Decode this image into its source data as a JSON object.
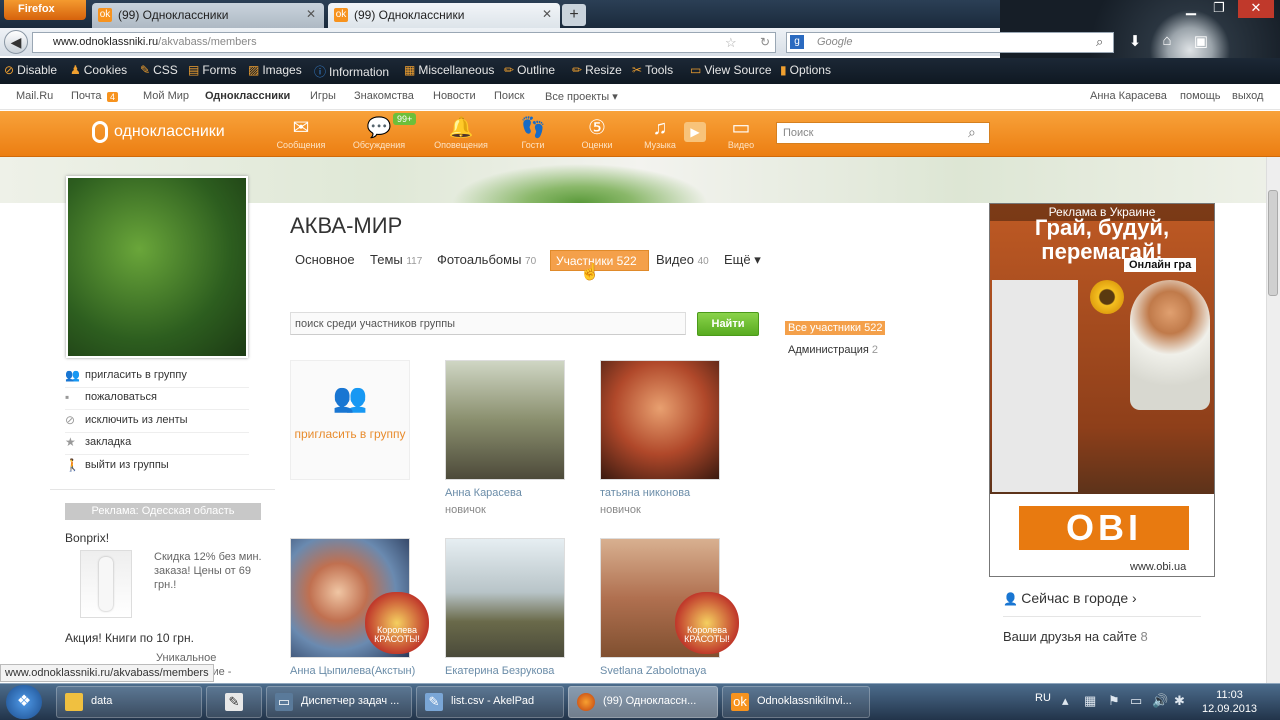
{
  "browser": {
    "menu_button": "Firefox",
    "tabs": [
      {
        "label": "(99) Одноклассники",
        "active": false
      },
      {
        "label": "(99) Одноклассники",
        "active": true
      }
    ],
    "url_domain": "www.odnoklassniki.ru",
    "url_path": "/akvabass/members",
    "search_placeholder": "Google",
    "bookmarks": [
      "Disable",
      "Cookies",
      "CSS",
      "Forms",
      "Images",
      "Information",
      "Miscellaneous",
      "Outline",
      "Resize",
      "Tools",
      "View Source",
      "Options"
    ]
  },
  "site_topline": {
    "links": [
      "Mail.Ru",
      "Почта",
      "Мой Мир",
      "Одноклассники",
      "Игры",
      "Знакомства",
      "Новости",
      "Поиск",
      "Все проекты ▾"
    ],
    "mail_badge": "4",
    "user_name": "Анна Карасева",
    "help": "помощь",
    "logout": "выход"
  },
  "ok_header": {
    "logo": "одноклассники",
    "items": [
      {
        "label": "Сообщения",
        "icon": "envelope-icon"
      },
      {
        "label": "Обсуждения",
        "icon": "chat-icon"
      },
      {
        "label": "Оповещения",
        "icon": "bell-icon"
      },
      {
        "label": "Гости",
        "icon": "footprints-icon"
      },
      {
        "label": "Оценки",
        "icon": "rating-icon"
      },
      {
        "label": "Музыка",
        "icon": "music-icon"
      },
      {
        "label": "Видео",
        "icon": "video-icon"
      }
    ],
    "discussions_badge": "99+",
    "search_placeholder": "Поиск"
  },
  "left": {
    "actions": [
      "пригласить в группу",
      "пожаловаться",
      "исключить из ленты",
      "закладка",
      "выйти из группы"
    ],
    "ad_title": "Реклама: Одесская область",
    "ad1_title": "Bonprix!",
    "ad1_text": "Скидка 12% без мин. заказа! Цены от 69 грн.!",
    "ad2_title": "Акция! Книги по 10 грн.",
    "ad2_text": "Уникальное предложение -"
  },
  "group": {
    "title": "АКВА-МИР",
    "tabs": [
      {
        "label": "Основное",
        "count": ""
      },
      {
        "label": "Темы",
        "count": "117"
      },
      {
        "label": "Фотоальбомы",
        "count": "70"
      },
      {
        "label": "Участники",
        "count": "522"
      },
      {
        "label": "Видео",
        "count": "40"
      },
      {
        "label": "Ещё ▾",
        "count": ""
      }
    ],
    "active_tab": "Участники 522",
    "member_search_placeholder": "поиск среди участников группы",
    "find_button": "Найти",
    "filter_all": "Все участники 522",
    "filter_admin": "Администрация",
    "filter_admin_count": "2",
    "invite_card": "пригласить в группу",
    "members": [
      {
        "name": "Анна Карасева",
        "status": "новичок"
      },
      {
        "name": "татьяна никонова",
        "status": "новичок"
      },
      {
        "name": "Анна Цыпилева(Акстын)",
        "status": ""
      },
      {
        "name": "Екатерина Безрукова",
        "status": ""
      },
      {
        "name": "Svetlana Zabolotnaya",
        "status": ""
      }
    ],
    "photo_sticker": "Королева КРАСОТЫ!"
  },
  "right": {
    "ad_top": "Реклама в Украине",
    "ad_headline": "Грай, будуй, перемагай!",
    "ad_badge": "Онлайн гра",
    "ad_brand": "OBI",
    "ad_url": "www.obi.ua",
    "city_link": "Сейчас в городе ›",
    "friends_label": "Ваши друзья на сайте",
    "friends_count": "8"
  },
  "status_url": "www.odnoklassniki.ru/akvabass/members",
  "taskbar": {
    "items": [
      "data",
      "",
      "Диспетчер задач ...",
      "list.csv - AkelPad",
      "(99) Одноклассн...",
      "OdnoklassnikiInvi..."
    ],
    "lang": "RU",
    "time": "11:03",
    "date": "12.09.2013"
  }
}
